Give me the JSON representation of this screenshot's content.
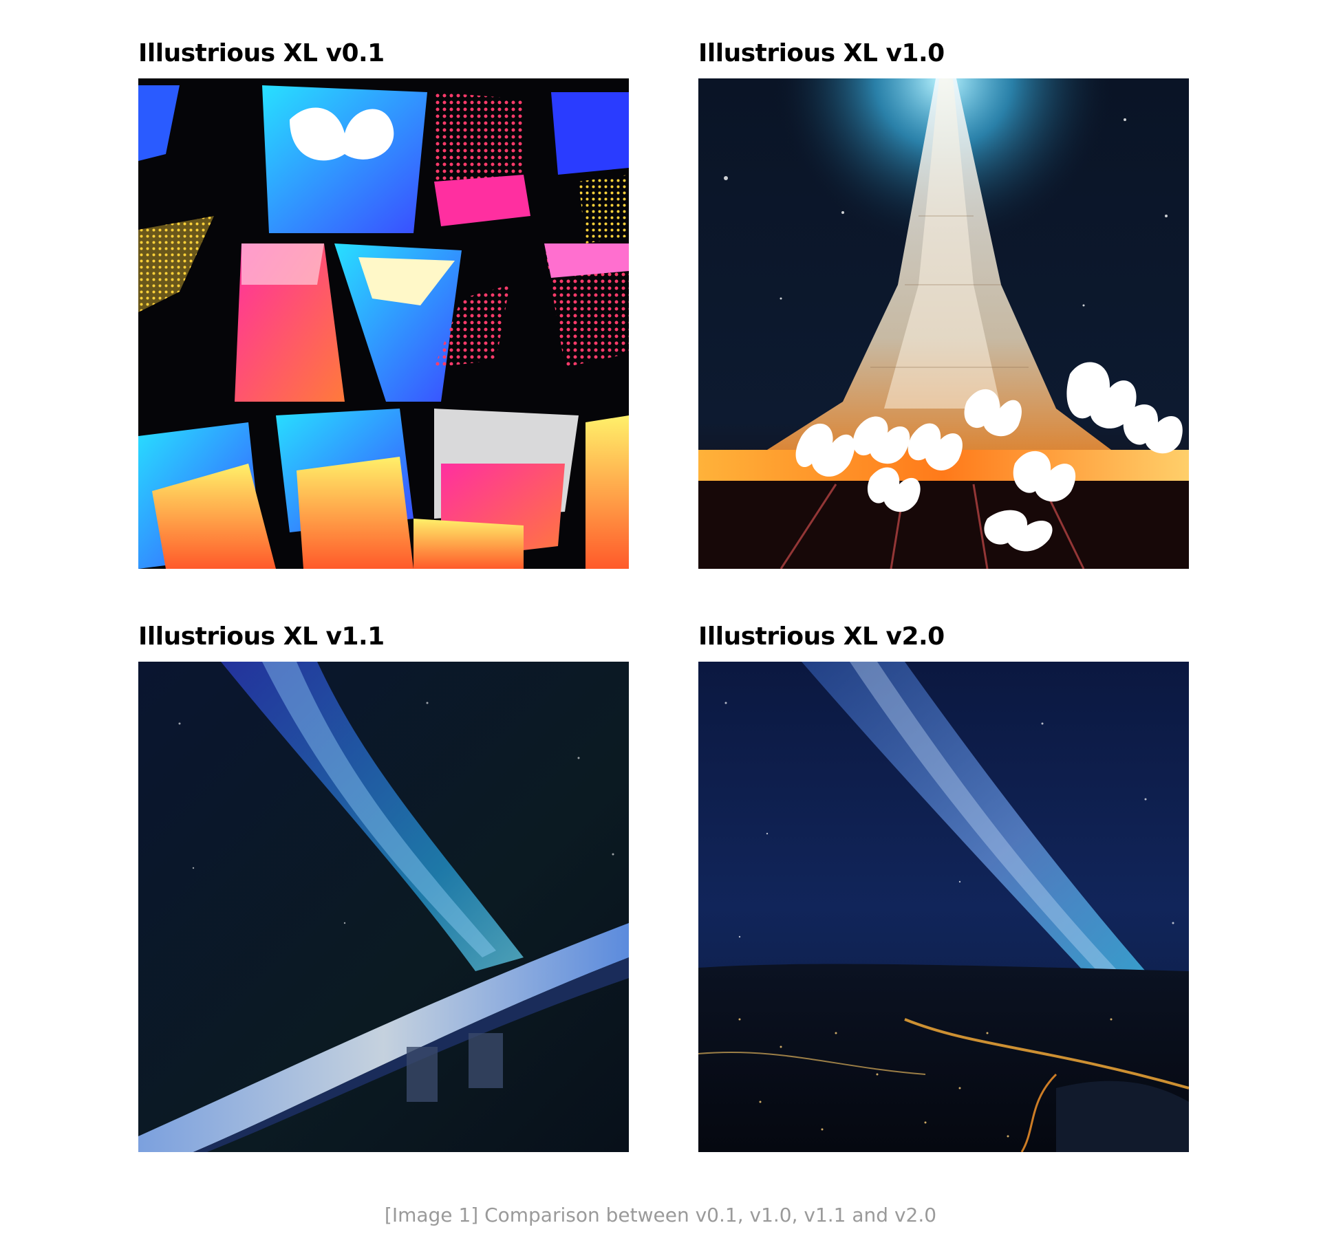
{
  "figure": {
    "panels": [
      {
        "title": "Illustrious XL v0.1",
        "image": "Abstract neon pop-art collage with butterflies"
      },
      {
        "title": "Illustrious XL v1.0",
        "image": "Illuminated tower at night with white butterflies"
      },
      {
        "title": "Illustrious XL v1.1",
        "image": "Milky way over a curved glowing city horizon"
      },
      {
        "title": "Illustrious XL v2.0",
        "image": "Milky way over night city lights landscape"
      }
    ],
    "caption": "[Image 1] Comparison between v0.1, v1.0, v1.1 and v2.0"
  }
}
